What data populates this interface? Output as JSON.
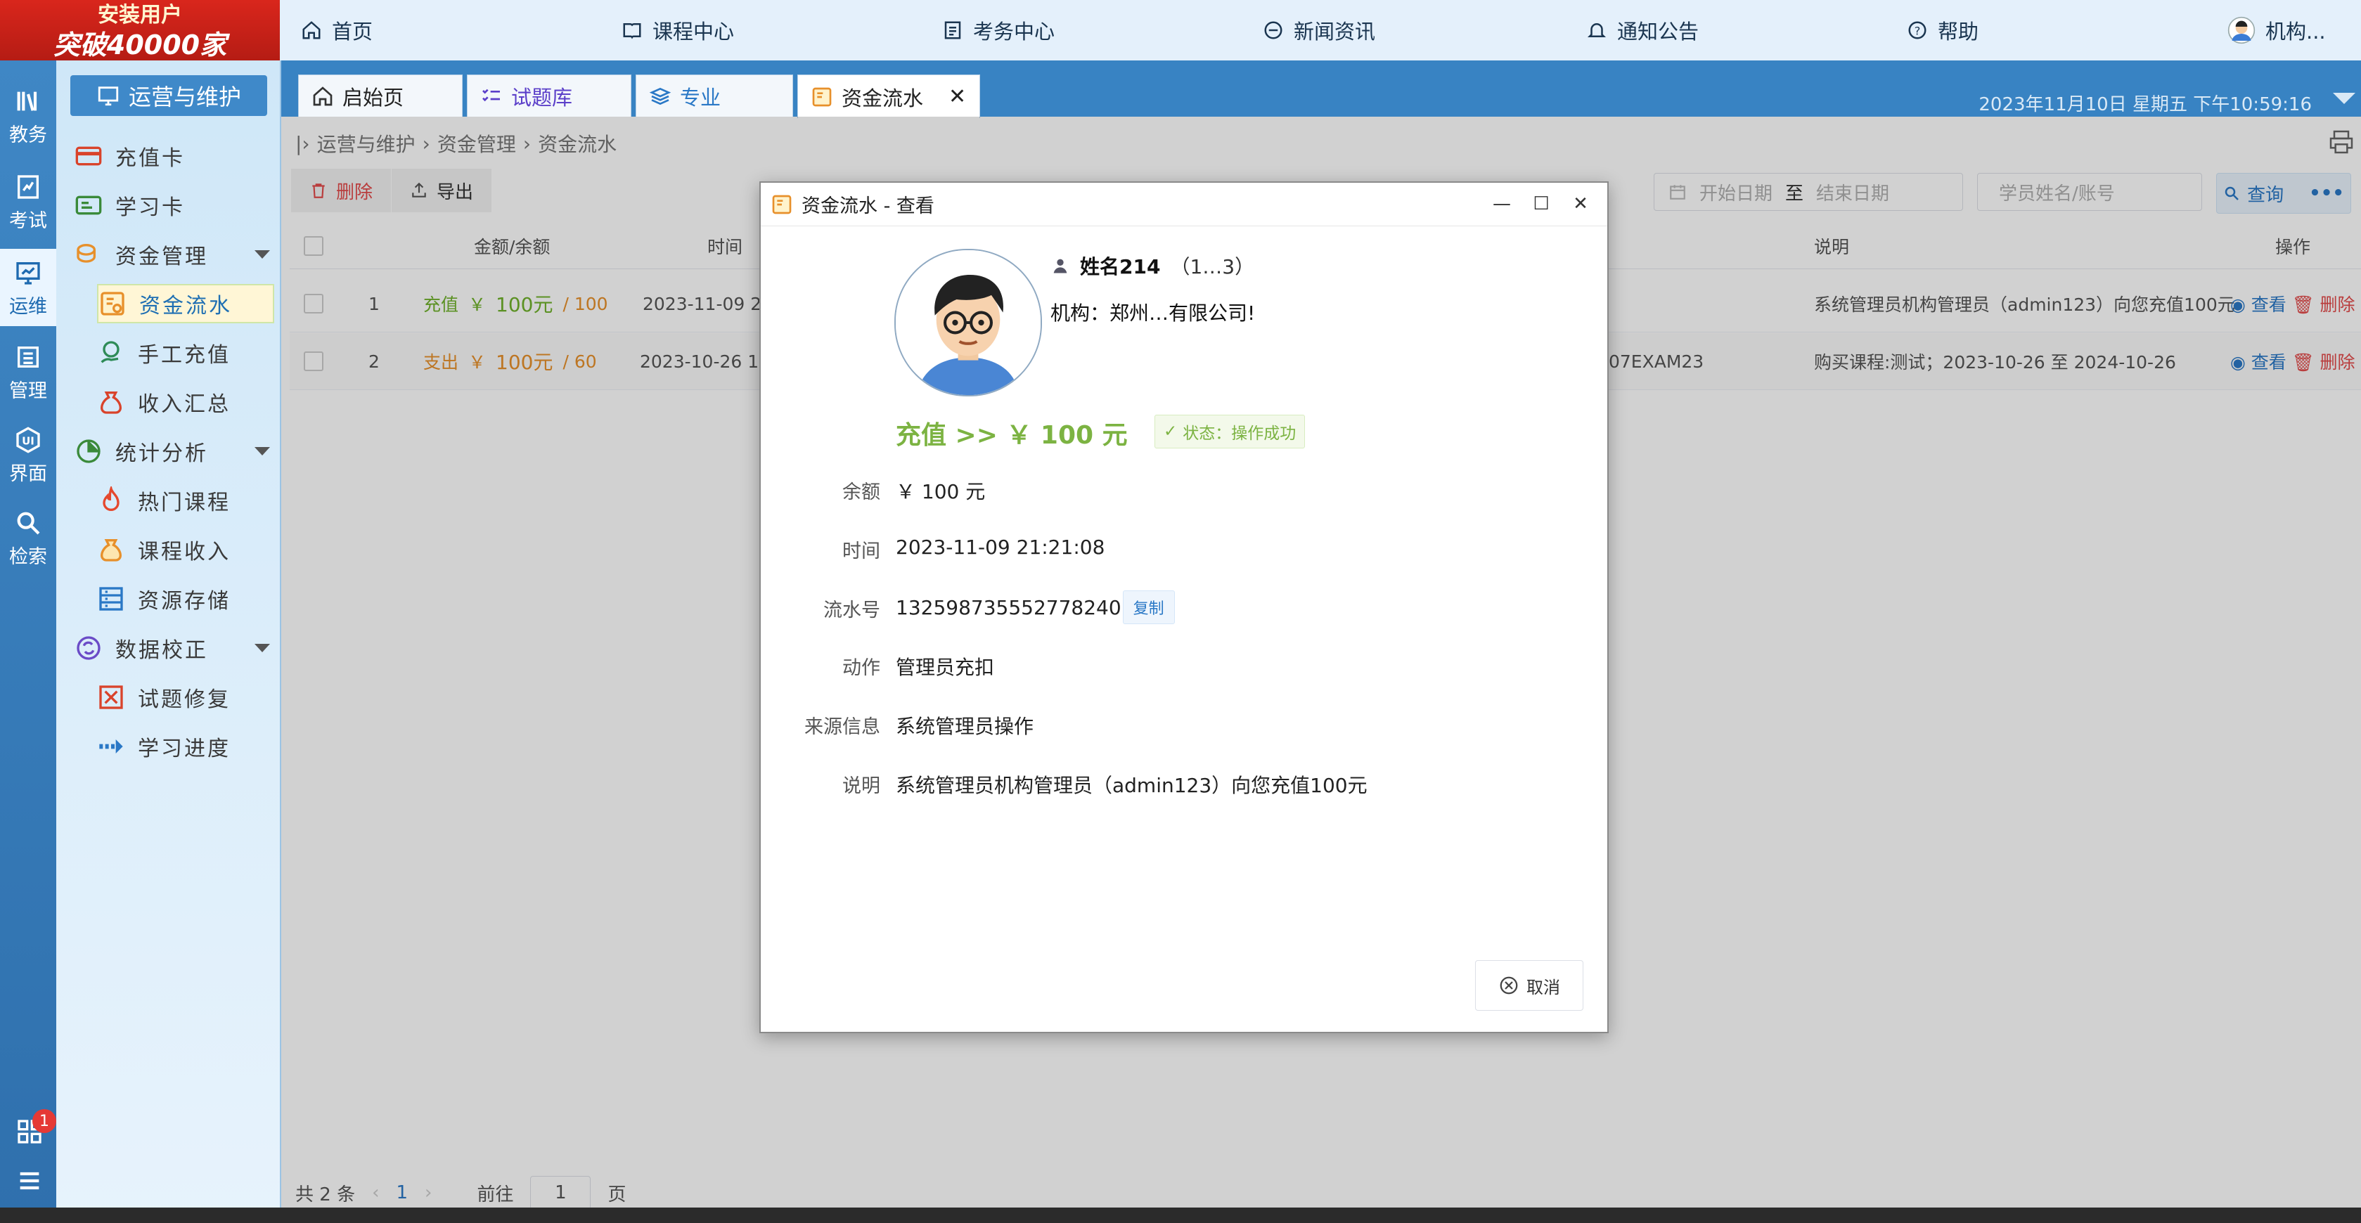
{
  "promo": {
    "line1": "安装用户",
    "line2": "突破40000家"
  },
  "topnav": {
    "home": "首页",
    "courses": "课程中心",
    "exams": "考务中心",
    "news": "新闻资讯",
    "notice": "通知公告",
    "help": "帮助",
    "user": "机构..."
  },
  "iconbar": [
    {
      "label": "教务",
      "icon": "bookshelf-icon"
    },
    {
      "label": "考试",
      "icon": "exam-icon"
    },
    {
      "label": "运维",
      "icon": "monitor-icon"
    },
    {
      "label": "管理",
      "icon": "list-icon"
    },
    {
      "label": "界面",
      "icon": "ui-icon"
    },
    {
      "label": "检索",
      "icon": "search-icon"
    }
  ],
  "iconbar_badge": "1",
  "menu": {
    "title": "运营与维护",
    "items": [
      {
        "label": "充值卡"
      },
      {
        "label": "学习卡"
      },
      {
        "label": "资金管理"
      },
      {
        "label": "资金流水"
      },
      {
        "label": "手工充值"
      },
      {
        "label": "收入汇总"
      },
      {
        "label": "统计分析"
      },
      {
        "label": "热门课程"
      },
      {
        "label": "课程收入"
      },
      {
        "label": "资源存储"
      },
      {
        "label": "数据校正"
      },
      {
        "label": "试题修复"
      },
      {
        "label": "学习进度"
      }
    ]
  },
  "tabs": [
    {
      "label": "启始页"
    },
    {
      "label": "试题库"
    },
    {
      "label": "专业"
    },
    {
      "label": "资金流水"
    }
  ],
  "datetime": "2023年11月10日 星期五 下午10:59:16",
  "breadcrumb": [
    "运营与维护",
    "资金管理",
    "资金流水"
  ],
  "toolbar": {
    "delete": "删除",
    "export": "导出"
  },
  "filters": {
    "start_date": "开始日期",
    "to": "至",
    "end_date": "结束日期",
    "student": "学员姓名/账号",
    "query": "查询"
  },
  "table": {
    "headers": {
      "amount": "金额/余额",
      "time": "时间",
      "desc": "说明",
      "ops": "操作"
    },
    "rows": [
      {
        "index": "1",
        "type": "充值",
        "currency": "￥",
        "amount": "100元",
        "balance": "/ 100",
        "time": "2023-11-09 21",
        "code": "",
        "desc": "系统管理员机构管理员（admin123）向您充值100元",
        "view": "查看",
        "del": "删除"
      },
      {
        "index": "2",
        "type": "支出",
        "currency": "￥",
        "amount": "100元",
        "balance": "/ 60",
        "time": "2023-10-26 12",
        "code": "07EXAM23",
        "desc": "购买课程:测试；2023-10-26 至 2024-10-26",
        "view": "查看",
        "del": "删除"
      }
    ]
  },
  "pager": {
    "total": "共 2 条",
    "page": "1",
    "goto": "前往",
    "goto_value": "1",
    "page_unit": "页"
  },
  "dialog": {
    "title": "资金流水 - 查看",
    "name": "姓名214",
    "account": "（1…3）",
    "org": "机构：郑州…有限公司!",
    "headline": "充值 >> ￥ 100 元",
    "status": "状态：操作成功",
    "fields": [
      {
        "label": "余额",
        "value": "￥ 100 元"
      },
      {
        "label": "时间",
        "value": "2023-11-09 21:21:08"
      },
      {
        "label": "流水号",
        "value": "1325987355527782​40"
      },
      {
        "label": "动作",
        "value": "管理员充扣"
      },
      {
        "label": "来源信息",
        "value": "系统管理员操作"
      },
      {
        "label": "说明",
        "value": "系统管理员机构管理员（admin123）向您充值100元"
      }
    ],
    "copy": "复制",
    "cancel": "取消"
  },
  "colors": {
    "accent": "#3f89c9",
    "green": "#6fb12b",
    "orange": "#e7902b",
    "red": "#e24b4b",
    "link": "#2a78c6"
  }
}
